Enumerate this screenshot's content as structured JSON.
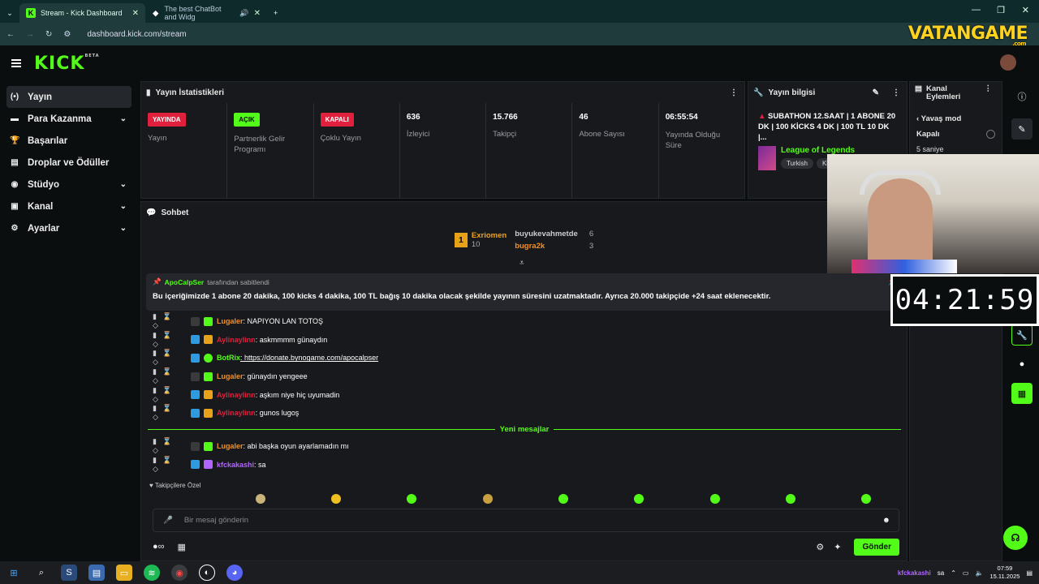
{
  "browser": {
    "tabs": [
      {
        "title": "Stream - Kick Dashboard",
        "active": true
      },
      {
        "title": "The best ChatBot and Widg",
        "active": false
      }
    ],
    "url": "dashboard.kick.com/stream",
    "watermark": "VATANGAME",
    "watermark_domain": ".com"
  },
  "header": {
    "logo": "KICK",
    "logo_badge": "BETA"
  },
  "sidebar": {
    "items": [
      {
        "label": "Yayın",
        "icon": "broadcast-icon",
        "expandable": false,
        "active": true
      },
      {
        "label": "Para Kazanma",
        "icon": "money-icon",
        "expandable": true
      },
      {
        "label": "Başarılar",
        "icon": "trophy-icon",
        "expandable": false
      },
      {
        "label": "Droplar ve Ödüller",
        "icon": "gift-icon",
        "expandable": false
      },
      {
        "label": "Stüdyo",
        "icon": "camera-icon",
        "expandable": true
      },
      {
        "label": "Kanal",
        "icon": "channel-icon",
        "expandable": true
      },
      {
        "label": "Ayarlar",
        "icon": "gear-icon",
        "expandable": true
      }
    ]
  },
  "stats": {
    "title": "Yayın İstatistikleri",
    "cards": [
      {
        "badge": "YAYINDA",
        "badge_color": "#e0203c",
        "label": "Yayın"
      },
      {
        "badge": "AÇIK",
        "badge_color": "#53fc18",
        "label": "Partnerlik Gelir Programı"
      },
      {
        "badge": "KAPALI",
        "badge_color": "#e0203c",
        "label": "Çoklu Yayın"
      },
      {
        "value": "636",
        "label": "İzleyici"
      },
      {
        "value": "15.766",
        "label": "Takipçi"
      },
      {
        "value": "46",
        "label": "Abone Sayısı"
      },
      {
        "value": "06:55:54",
        "label": "Yayında Olduğu Süre"
      }
    ]
  },
  "stream_info": {
    "title": "Yayın bilgisi",
    "stream_title": "SUBATHON 12.SAAT | 1 ABONE 20 DK | 100 KİCKS 4 DK | 100 TL 10 DK |...",
    "game": "League of Legends",
    "tags": [
      "Turkish",
      "Kh"
    ]
  },
  "channel_actions": {
    "title_line1": "Kanal",
    "title_line2": "Eylemleri",
    "slow_mode_label": "Yavaş mod",
    "option_off": "Kapalı",
    "option_5s": "5 saniye"
  },
  "chat": {
    "title": "Sohbet",
    "top_donors": [
      {
        "rank": "1",
        "name": "Exriomen",
        "count": "10"
      },
      {
        "name": "buyukevahmetde",
        "count": "6"
      },
      {
        "name": "bugra2k",
        "count": "3"
      }
    ],
    "pinned": {
      "author": "ApoCalpSer",
      "pinned_label": "tarafından sabitlendi",
      "message": "Bu içeriğimizde 1 abone 20 dakika, 100 kicks 4 dakika, 100 TL bağış 10 dakika olacak şekilde yayının süresini uzatmaktadır. Ayrıca 20.000 takipçide +24 saat eklenecektir."
    },
    "messages": [
      {
        "user": "Lugaler",
        "text": ": NAPIYON LAN TOTOŞ",
        "color": "orange"
      },
      {
        "user": "Aylinaylinn",
        "text": ": askmmmm günaydın",
        "color": "red"
      },
      {
        "user": "BotRix",
        "text": ": https://donate.bynogame.com/apocalpser",
        "color": "green"
      },
      {
        "user": "Lugaler",
        "text": ": günaydın yengeee",
        "color": "orange"
      },
      {
        "user": "Aylinaylinn",
        "text": ": aşkım niye hiç uyumadin",
        "color": "red"
      },
      {
        "user": "Aylinaylinn",
        "text": ": gunos lugoş",
        "color": "red"
      }
    ],
    "new_messages_label": "Yeni mesajlar",
    "messages_after": [
      {
        "user": "Lugaler",
        "text": ": abi başka oyun ayarlamadın mı",
        "color": "orange"
      },
      {
        "user": "kfckakashi",
        "text": ": sa",
        "color": "purple"
      }
    ],
    "emote_section": "Takipçilere Özel",
    "input_placeholder": "Bir mesaj gönderin",
    "send_label": "Gönder"
  },
  "overlay": {
    "timer": "04:21:59"
  },
  "taskbar": {
    "notification": "kfckakashi",
    "notification_text": "sa",
    "time": "07:59",
    "date": "15.11.2025"
  }
}
